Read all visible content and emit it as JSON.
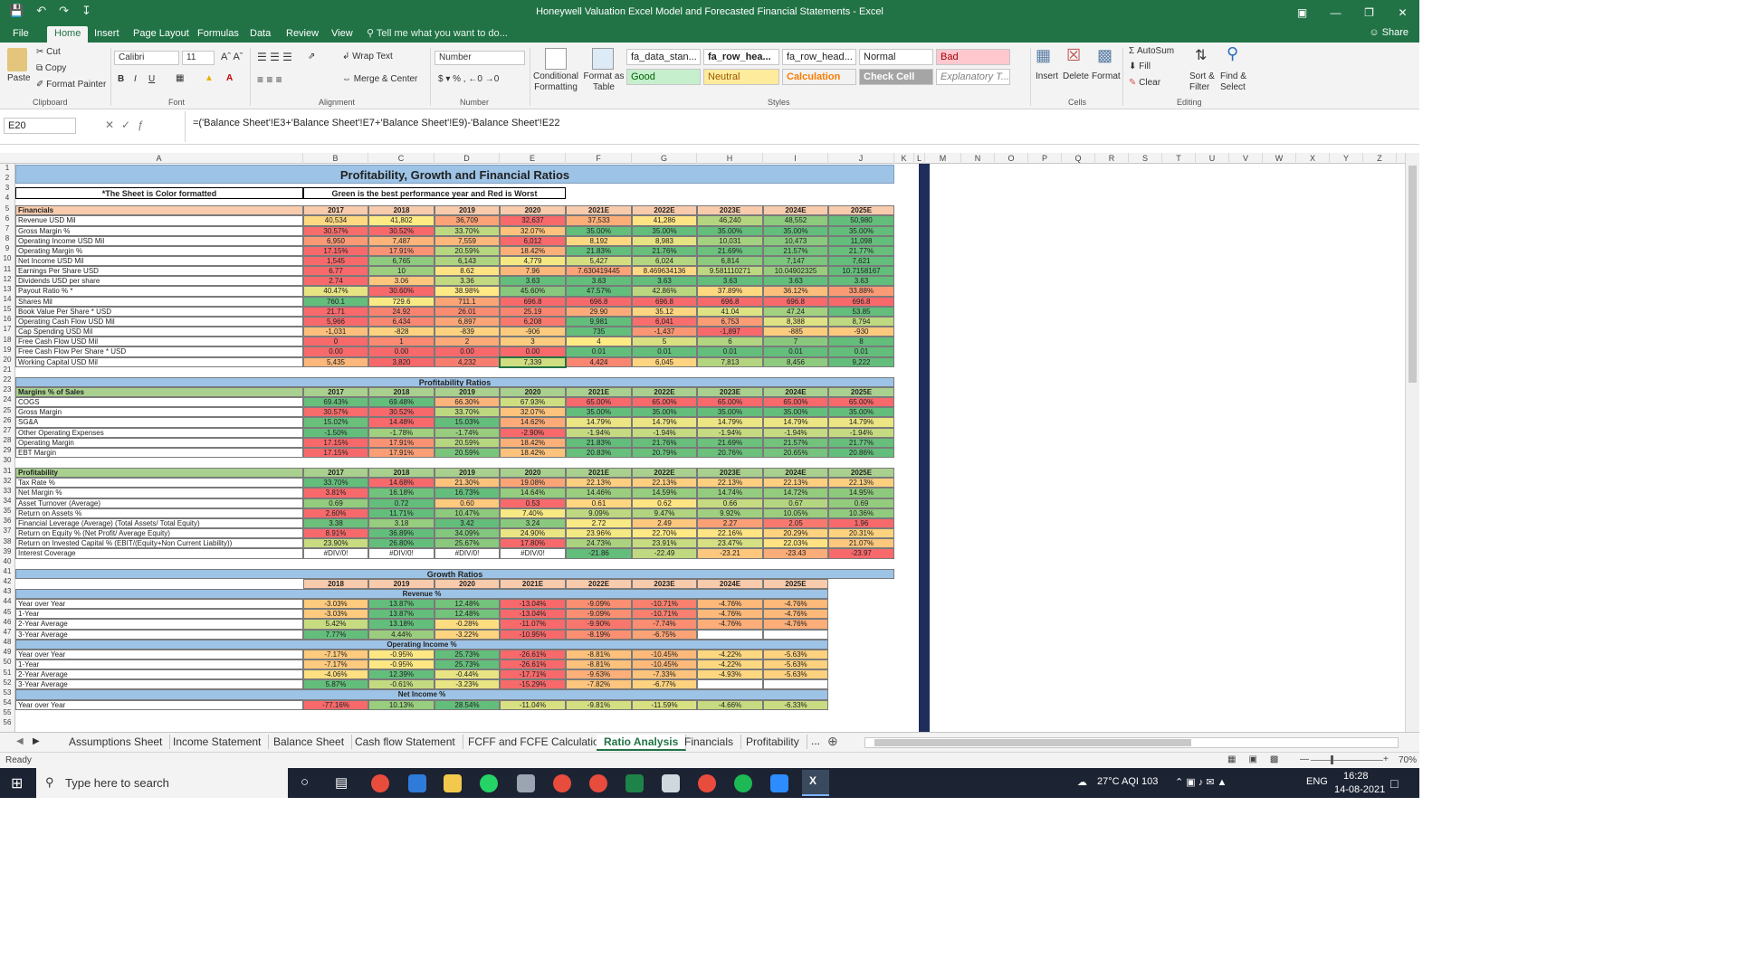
{
  "window": {
    "title": "Honeywell Valuation Excel Model and Forecasted Financial Statements - Excel"
  },
  "ribbon_tabs": [
    "File",
    "Home",
    "Insert",
    "Page Layout",
    "Formulas",
    "Data",
    "Review",
    "View"
  ],
  "tell_me": "Tell me what you want to do...",
  "share": "Share",
  "clipboard": {
    "paste": "Paste",
    "cut": "Cut",
    "copy": "Copy",
    "format_painter": "Format Painter",
    "label": "Clipboard"
  },
  "font": {
    "name": "Calibri",
    "size": "11",
    "label": "Font"
  },
  "alignment": {
    "wrap": "Wrap Text",
    "merge": "Merge & Center",
    "label": "Alignment"
  },
  "number": {
    "format": "Number",
    "label": "Number"
  },
  "styles": {
    "cond": "Conditional Formatting",
    "table": "Format as Table",
    "label": "Styles",
    "cells": [
      "fa_data_stan...",
      "fa_row_hea...",
      "fa_row_head...",
      "Normal",
      "Bad",
      "Good",
      "Neutral",
      "Calculation",
      "Check Cell",
      "Explanatory T..."
    ]
  },
  "cells_grp": {
    "insert": "Insert",
    "delete": "Delete",
    "format": "Format",
    "label": "Cells"
  },
  "editing": {
    "autosum": "AutoSum",
    "fill": "Fill",
    "clear": "Clear",
    "sort": "Sort & Filter",
    "find": "Find & Select",
    "label": "Editing"
  },
  "name_box": "E20",
  "formula": "=('Balance Sheet'!E3+'Balance Sheet'!E7+'Balance Sheet'!E9)-'Balance Sheet'!E22",
  "columns": [
    "A",
    "B",
    "C",
    "D",
    "E",
    "F",
    "G",
    "H",
    "I",
    "J",
    "K",
    "L",
    "M",
    "N",
    "O",
    "P",
    "Q",
    "R",
    "S",
    "T",
    "U",
    "V",
    "W",
    "X",
    "Y",
    "Z"
  ],
  "sheet": {
    "title": "Profitability, Growth and Financial Ratios",
    "note_left": "*The Sheet is Color formatted",
    "note_right": "Green is the best performance year and Red is Worst",
    "years": [
      "2017",
      "2018",
      "2019",
      "2020",
      "2021E",
      "2022E",
      "2023E",
      "2024E",
      "2025E"
    ],
    "fin_header": "Financials",
    "fin_rows": [
      [
        "Revenue USD Mil",
        "40,534",
        "41,802",
        "36,709",
        "32,637",
        "37,533",
        "41,286",
        "46,240",
        "48,552",
        "50,980"
      ],
      [
        "Gross Margin %",
        "30.57%",
        "30.52%",
        "33.70%",
        "32.07%",
        "35.00%",
        "35.00%",
        "35.00%",
        "35.00%",
        "35.00%"
      ],
      [
        "Operating Income USD Mil",
        "6,950",
        "7,487",
        "7,559",
        "6,012",
        "8,192",
        "8,983",
        "10,031",
        "10,473",
        "11,098"
      ],
      [
        "Operating Margin %",
        "17.15%",
        "17.91%",
        "20.59%",
        "18.42%",
        "21.83%",
        "21.76%",
        "21.69%",
        "21.57%",
        "21.77%"
      ],
      [
        "Net Income USD Mil",
        "1,545",
        "6,765",
        "6,143",
        "4,779",
        "5,427",
        "6,024",
        "6,814",
        "7,147",
        "7,621"
      ],
      [
        "Earnings Per Share USD",
        "6.77",
        "10",
        "8.62",
        "7.96",
        "7.630419445",
        "8.469634136",
        "9.581110271",
        "10.04902325",
        "10.7158167"
      ],
      [
        "Dividends USD per share",
        "2.74",
        "3.06",
        "3.36",
        "3.63",
        "3.63",
        "3.63",
        "3.63",
        "3.63",
        "3.63"
      ],
      [
        "Payout Ratio % *",
        "40.47%",
        "30.60%",
        "38.98%",
        "45.60%",
        "47.57%",
        "42.86%",
        "37.89%",
        "36.12%",
        "33.88%"
      ],
      [
        "Shares Mil",
        "760.1",
        "729.6",
        "711.1",
        "696.8",
        "696.8",
        "696.8",
        "696.8",
        "696.8",
        "696.8"
      ],
      [
        "Book Value Per Share * USD",
        "21.71",
        "24.92",
        "26.01",
        "25.19",
        "29.90",
        "35.12",
        "41.04",
        "47.24",
        "53.85"
      ],
      [
        "Operating Cash Flow USD Mil",
        "5,966",
        "6,434",
        "6,897",
        "6,208",
        "9,981",
        "6,041",
        "6,753",
        "8,388",
        "8,794"
      ],
      [
        "Cap Spending USD Mil",
        "-1,031",
        "-828",
        "-839",
        "-906",
        "735",
        "-1,437",
        "-1,897",
        "-885",
        "-930"
      ],
      [
        "Free Cash Flow USD Mil",
        "0",
        "1",
        "2",
        "3",
        "4",
        "5",
        "6",
        "7",
        "8"
      ],
      [
        "Free Cash Flow Per Share * USD",
        "0.00",
        "0.00",
        "0.00",
        "0.00",
        "0.01",
        "0.01",
        "0.01",
        "0.01",
        "0.01"
      ],
      [
        "Working Capital USD Mil",
        "5,435",
        "3,820",
        "4,232",
        "7,339",
        "4,424",
        "6,045",
        "7,813",
        "8,456",
        "9,222"
      ]
    ],
    "prof_title": "Profitability Ratios",
    "margins_header": "Margins % of Sales",
    "margin_rows": [
      [
        "COGS",
        "69.43%",
        "69.48%",
        "66.30%",
        "67.93%",
        "65.00%",
        "65.00%",
        "65.00%",
        "65.00%",
        "65.00%"
      ],
      [
        "Gross Margin",
        "30.57%",
        "30.52%",
        "33.70%",
        "32.07%",
        "35.00%",
        "35.00%",
        "35.00%",
        "35.00%",
        "35.00%"
      ],
      [
        "SG&A",
        "15.02%",
        "14.48%",
        "15.03%",
        "14.62%",
        "14.79%",
        "14.79%",
        "14.79%",
        "14.79%",
        "14.79%"
      ],
      [
        "Other Operating Expenses",
        "-1.50%",
        "-1.78%",
        "-1.74%",
        "-2.90%",
        "-1.94%",
        "-1.94%",
        "-1.94%",
        "-1.94%",
        "-1.94%"
      ],
      [
        "Operating Margin",
        "17.15%",
        "17.91%",
        "20.59%",
        "18.42%",
        "21.83%",
        "21.76%",
        "21.69%",
        "21.57%",
        "21.77%"
      ],
      [
        "EBT Margin",
        "17.15%",
        "17.91%",
        "20.59%",
        "18.42%",
        "20.83%",
        "20.79%",
        "20.76%",
        "20.65%",
        "20.86%"
      ]
    ],
    "profitability_header": "Profitability",
    "prof_rows": [
      [
        "Tax Rate %",
        "33.70%",
        "14.68%",
        "21.30%",
        "19.08%",
        "22.13%",
        "22.13%",
        "22.13%",
        "22.13%",
        "22.13%"
      ],
      [
        "Net Margin %",
        "3.81%",
        "16.18%",
        "16.73%",
        "14.64%",
        "14.46%",
        "14.59%",
        "14.74%",
        "14.72%",
        "14.95%"
      ],
      [
        "Asset Turnover (Average)",
        "0.69",
        "0.72",
        "0.60",
        "0.53",
        "0.61",
        "0.62",
        "0.66",
        "0.67",
        "0.69"
      ],
      [
        "Return on Assets %",
        "2.60%",
        "11.71%",
        "10.47%",
        "7.40%",
        "9.09%",
        "9.47%",
        "9.92%",
        "10.05%",
        "10.36%"
      ],
      [
        "Financial Leverage (Average) (Total Assets/ Total Equity)",
        "3.38",
        "3.18",
        "3.42",
        "3.24",
        "2.72",
        "2.49",
        "2.27",
        "2.05",
        "1.96"
      ],
      [
        "Return on Equity % (Net Profit/ Average Equity)",
        "8.91%",
        "36.89%",
        "34.09%",
        "24.90%",
        "23.96%",
        "22.70%",
        "22.16%",
        "20.29%",
        "20.31%"
      ],
      [
        "Return on Invested Capital % (EBIT/(Equity+Non Current Liability))",
        "23.90%",
        "26.80%",
        "25.67%",
        "17.80%",
        "24.73%",
        "23.91%",
        "23.47%",
        "22.03%",
        "21.07%"
      ],
      [
        "Interest Coverage",
        "#DIV/0!",
        "#DIV/0!",
        "#DIV/0!",
        "#DIV/0!",
        "-21.86",
        "-22.49",
        "-23.21",
        "-23.43",
        "-23.97"
      ]
    ],
    "growth_title": "Growth Ratios",
    "growth_years": [
      "2018",
      "2019",
      "2020",
      "2021E",
      "2022E",
      "2023E",
      "2024E",
      "2025E"
    ],
    "rev_header": "Revenue %",
    "rev_rows": [
      [
        "Year over Year",
        "-3.03%",
        "13.87%",
        "12.48%",
        "-13.04%",
        "-9.09%",
        "-10.71%",
        "-4.76%",
        "-4.76%"
      ],
      [
        "1-Year",
        "-3.03%",
        "13.87%",
        "12.48%",
        "-13.04%",
        "-9.09%",
        "-10.71%",
        "-4.76%",
        "-4.76%"
      ],
      [
        "2-Year Average",
        "5.42%",
        "13.18%",
        "-0.28%",
        "-11.07%",
        "-9.90%",
        "-7.74%",
        "-4.76%",
        "-4.76%"
      ],
      [
        "3-Year Average",
        "7.77%",
        "4.44%",
        "-3.22%",
        "-10.95%",
        "-8.19%",
        "-6.75%",
        "",
        ""
      ]
    ],
    "opinc_header": "Operating Income %",
    "opinc_rows": [
      [
        "Year over Year",
        "-7.17%",
        "-0.95%",
        "25.73%",
        "-26.61%",
        "-8.81%",
        "-10.45%",
        "-4.22%",
        "-5.63%"
      ],
      [
        "1-Year",
        "-7.17%",
        "-0.95%",
        "25.73%",
        "-26.61%",
        "-8.81%",
        "-10.45%",
        "-4.22%",
        "-5.63%"
      ],
      [
        "2-Year Average",
        "-4.06%",
        "12.39%",
        "-0.44%",
        "-17.71%",
        "-9.63%",
        "-7.33%",
        "-4.93%",
        "-5.63%"
      ],
      [
        "3-Year Average",
        "5.87%",
        "-0.61%",
        "-3.23%",
        "-15.29%",
        "-7.82%",
        "-6.77%",
        "",
        ""
      ]
    ],
    "netinc_header": "Net Income %",
    "netinc_rows": [
      [
        "Year over Year",
        "-77.16%",
        "10.13%",
        "28.54%",
        "-11.04%",
        "-9.81%",
        "-11.59%",
        "-4.66%",
        "-6.33%"
      ]
    ]
  },
  "sheet_tabs": [
    "Assumptions Sheet",
    "Income Statement",
    "Balance Sheet",
    "Cash flow Statement",
    "FCFF and FCFE Calculation",
    "Ratio Analysis",
    "Financials",
    "Profitability"
  ],
  "active_tab": "Ratio Analysis",
  "status": {
    "ready": "Ready",
    "zoom": "70%"
  },
  "taskbar": {
    "search": "Type here to search",
    "weather": "27°C  AQI 103",
    "lang": "ENG",
    "time": "16:28",
    "date": "14-08-2021"
  },
  "colors": {
    "excel_green": "#217346",
    "header_orange": "#f8cbad",
    "header_green": "#a9d08e",
    "title_blue": "#9dc3e6",
    "navy": "#1f2d5a",
    "best": "#63be7b",
    "worst": "#f8696b",
    "mid": "#ffeb84"
  }
}
